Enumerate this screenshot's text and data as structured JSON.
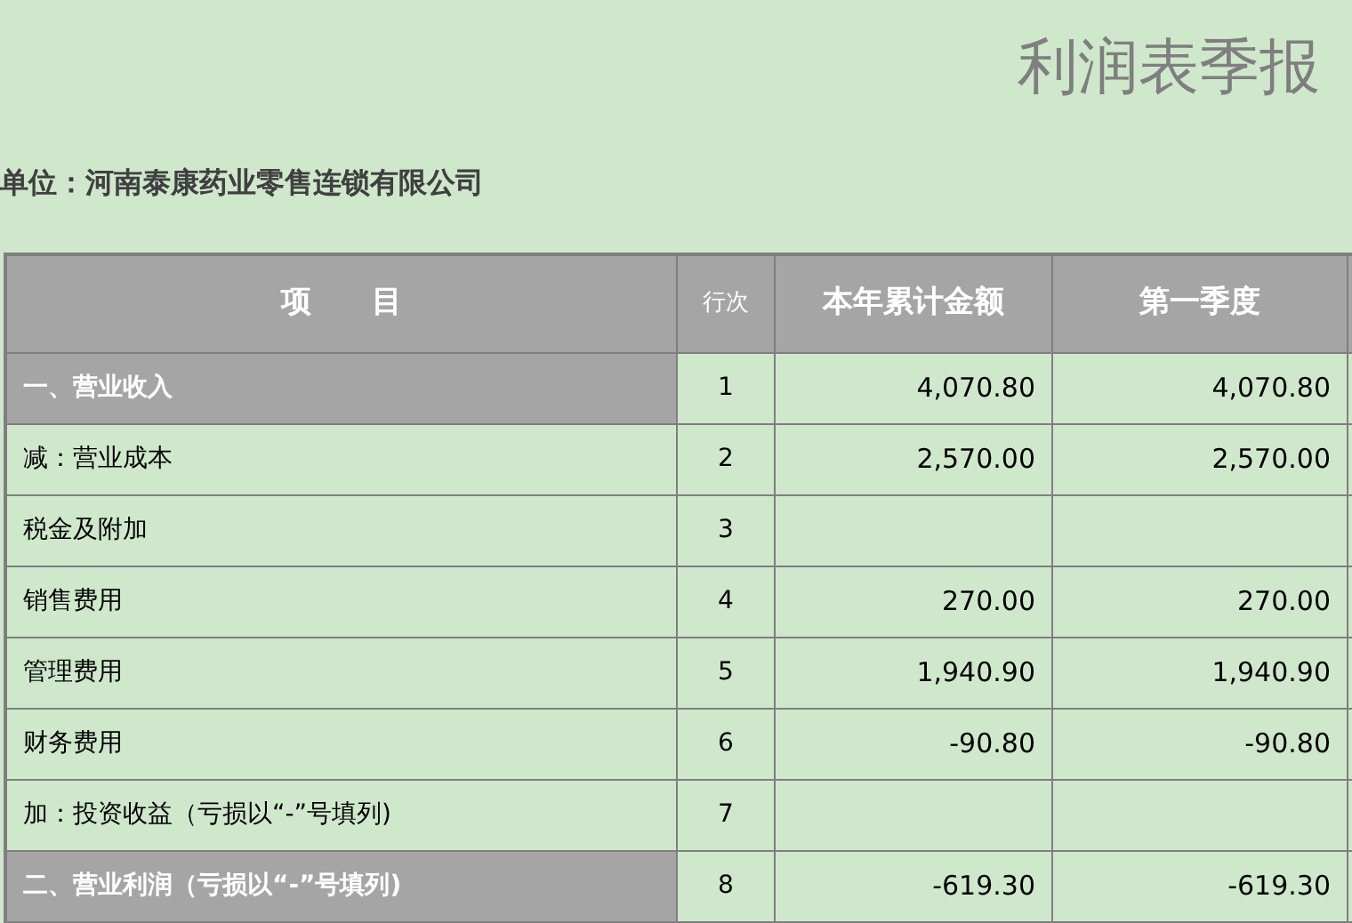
{
  "title": "利润表季报",
  "company": "单位：河南泰康药业零售连锁有限公司",
  "table": {
    "columns": [
      "项　　目",
      "行次",
      "本年累计金额",
      "第一季度"
    ],
    "rows": [
      {
        "kind": "section",
        "item": "一、营业收入",
        "line": "1",
        "ytd": "4,070.80",
        "q1": "4,070.80"
      },
      {
        "kind": "normal",
        "item": "减：营业成本",
        "line": "2",
        "ytd": "2,570.00",
        "q1": "2,570.00"
      },
      {
        "kind": "normal",
        "item": "税金及附加",
        "line": "3"
      },
      {
        "kind": "normal",
        "item": "销售费用",
        "line": "4",
        "ytd": "270.00",
        "q1": "270.00"
      },
      {
        "kind": "normal",
        "item": "管理费用",
        "line": "5",
        "ytd": "1,940.90",
        "q1": "1,940.90"
      },
      {
        "kind": "normal",
        "item": "财务费用",
        "line": "6",
        "ytd": "-90.80",
        "q1": "-90.80"
      },
      {
        "kind": "normal",
        "item": "加：投资收益（亏损以“-”号填列)",
        "line": "7"
      },
      {
        "kind": "section",
        "item": "二、营业利润（亏损以“-”号填列)",
        "line": "8",
        "ytd": "-619.30",
        "q1": "-619.30"
      }
    ]
  }
}
